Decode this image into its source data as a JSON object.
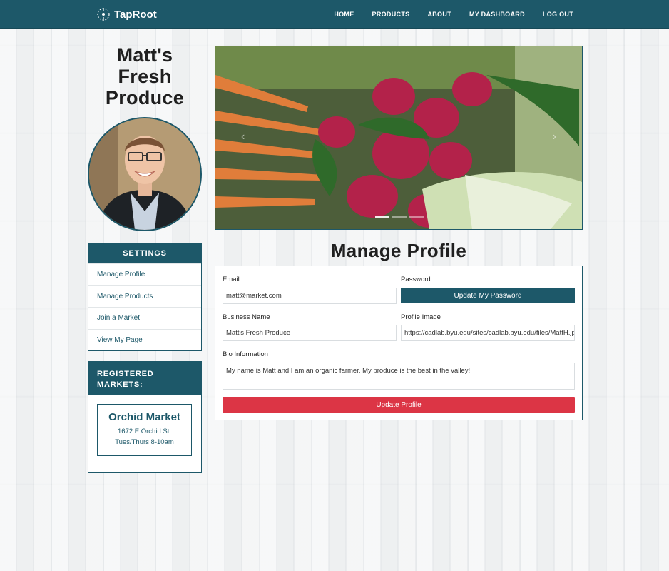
{
  "brand": {
    "name": "TapRoot",
    "logo_icon": "root-compass-icon"
  },
  "nav": {
    "items": [
      {
        "label": "HOME"
      },
      {
        "label": "PRODUCTS"
      },
      {
        "label": "ABOUT"
      },
      {
        "label": "MY DASHBOARD"
      },
      {
        "label": "LOG OUT"
      }
    ]
  },
  "store": {
    "title": "Matt's Fresh Produce"
  },
  "settings": {
    "title": "SETTINGS",
    "items": [
      {
        "label": "Manage Profile"
      },
      {
        "label": "Manage Products"
      },
      {
        "label": "Join a Market"
      },
      {
        "label": "View My Page"
      }
    ]
  },
  "markets": {
    "title": "REGISTERED MARKETS:",
    "items": [
      {
        "name": "Orchid Market",
        "address": "1672 E Orchid St.",
        "hours": "Tues/Thurs 8-10am"
      }
    ]
  },
  "carousel": {
    "prev_icon": "chevron-left-icon",
    "next_icon": "chevron-right-icon",
    "slide_count": 3,
    "active_slide": 1
  },
  "page": {
    "heading": "Manage Profile"
  },
  "form": {
    "email_label": "Email",
    "email_value": "matt@market.com",
    "password_label": "Password",
    "password_button": "Update My Password",
    "business_label": "Business Name",
    "business_value": "Matt's Fresh Produce",
    "image_label": "Profile Image",
    "image_value": "https://cadlab.byu.edu/sites/cadlab.byu.edu/files/MattH.jpg",
    "bio_label": "Bio Information",
    "bio_value": "My name is Matt and I am an organic farmer. My produce is the best in the valley!",
    "submit_button": "Update Profile"
  },
  "colors": {
    "primary": "#1d5869",
    "danger": "#dc3545"
  }
}
